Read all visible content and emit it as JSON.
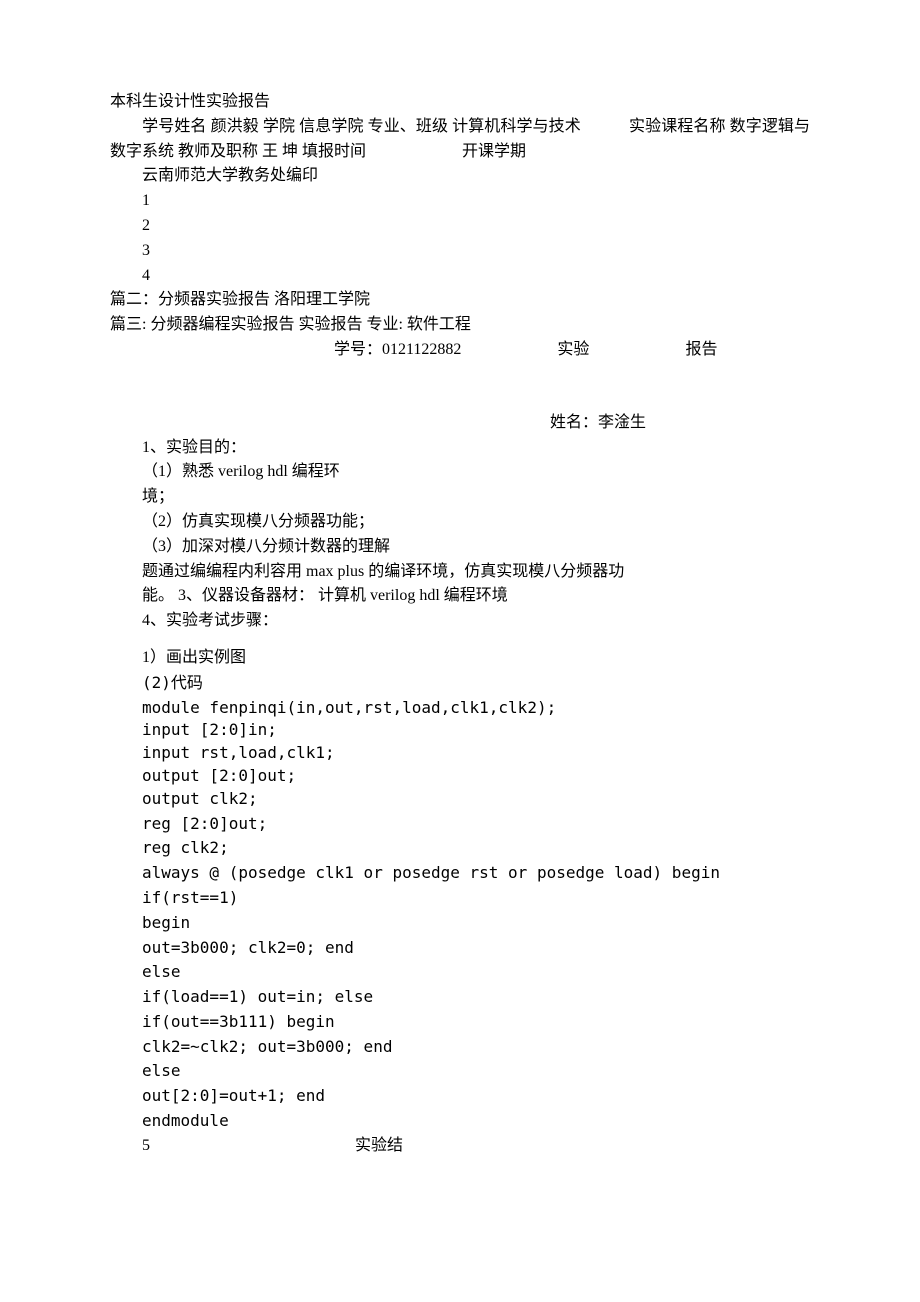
{
  "l01": "本科生设计性实验报告",
  "l02": "　　学号姓名 颜洪毅 学院 信息学院 专业、班级 计算机科学与技术　　　实验课程名称 数字逻辑与数字系统 教师及职称 王 坤 填报时间　　　　　　开课学期",
  "l03": "　　云南师范大学教务处编印",
  "l04": "　　1",
  "l05": "　　2",
  "l06": "　　3",
  "l07": "　　4",
  "l08": "篇二：分频器实验报告 洛阳理工学院",
  "l09": "篇三: 分频器编程实验报告 实验报告 专业: 软件工程",
  "l10a": "学号：0121122882",
  "l10b": "实验",
  "l10c": "报告",
  "l11": "姓名：李淦生",
  "l12": "1、实验目的：",
  "l13": "（1）熟悉 verilog hdl 编程环",
  "l14": "境；",
  "l15": "（2）仿真实现模八分频器功能；",
  "l16": "（3）加深对模八分频计数器的理解",
  "l17": "题通过编编程内利容用 max plus 的编译环境，仿真实现模八分频器功",
  "l18": "能。 3、仪器设备器材：  计算机 verilog hdl 编程环境",
  "l19": "4、实验考试步骤：",
  "l20": "  1）画出实例图",
  "l21": "(2)代码",
  "l22": "module fenpinqi(in,out,rst,load,clk1,clk2);",
  "l23": "input [2:0]in;",
  "l24": "input rst,load,clk1;",
  "l25": "output [2:0]out;",
  "l26": "output clk2;",
  "l27": "reg [2:0]out;",
  "l28": "reg clk2;",
  "l29": "always @ (posedge clk1 or posedge rst or posedge load) begin",
  "l30": "if(rst==1)",
  "l31": "begin",
  "l32": "out=3b000; clk2=0; end",
  "l33": "else",
  "l34": "if(load==1) out=in; else",
  "l35": "if(out==3b111) begin",
  "l36": "clk2=~clk2; out=3b000; end",
  "l37": "else",
  "l38": "out[2:0]=out+1; end",
  "l39": "endmodule",
  "l40a": "5",
  "l40b": "实验结"
}
